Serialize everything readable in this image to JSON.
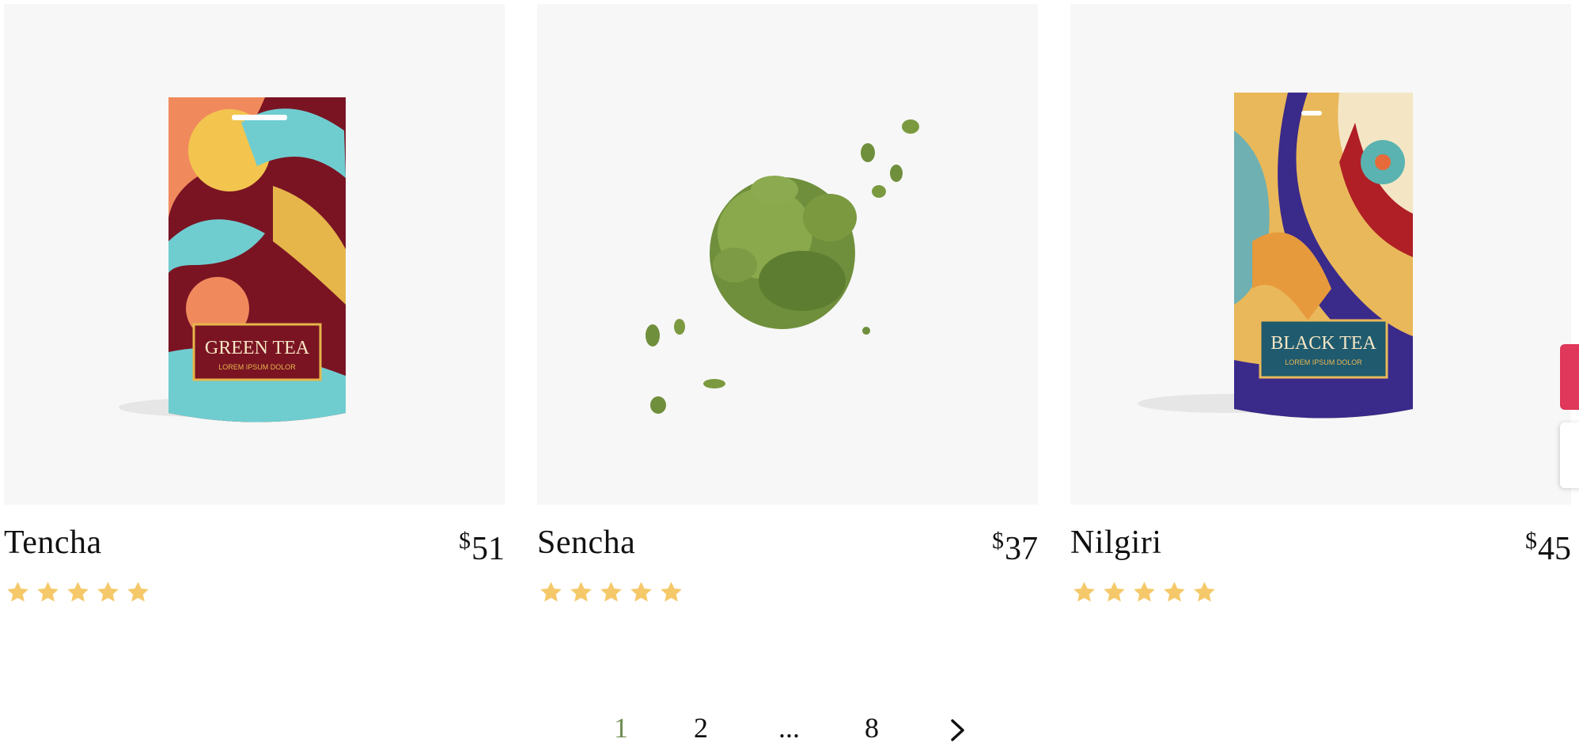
{
  "products": [
    {
      "name": "Tencha",
      "currency": "$",
      "price": "51",
      "rating": 5,
      "package_label": "GREEN TEA",
      "package_sublabel": "LOREM IPSUM DOLOR"
    },
    {
      "name": "Sencha",
      "currency": "$",
      "price": "37",
      "rating": 5
    },
    {
      "name": "Nilgiri",
      "currency": "$",
      "price": "45",
      "rating": 5,
      "package_label": "BLACK TEA",
      "package_sublabel": "LOREM IPSUM DOLOR"
    }
  ],
  "pagination": {
    "pages": [
      "1",
      "2",
      "...",
      "8"
    ],
    "current": "1",
    "next_icon": "chevron-right-icon"
  },
  "colors": {
    "star": "#f5c96a",
    "current_page": "#6f8f55",
    "side_tab_accent": "#e0385a",
    "image_background": "#f7f7f7"
  }
}
